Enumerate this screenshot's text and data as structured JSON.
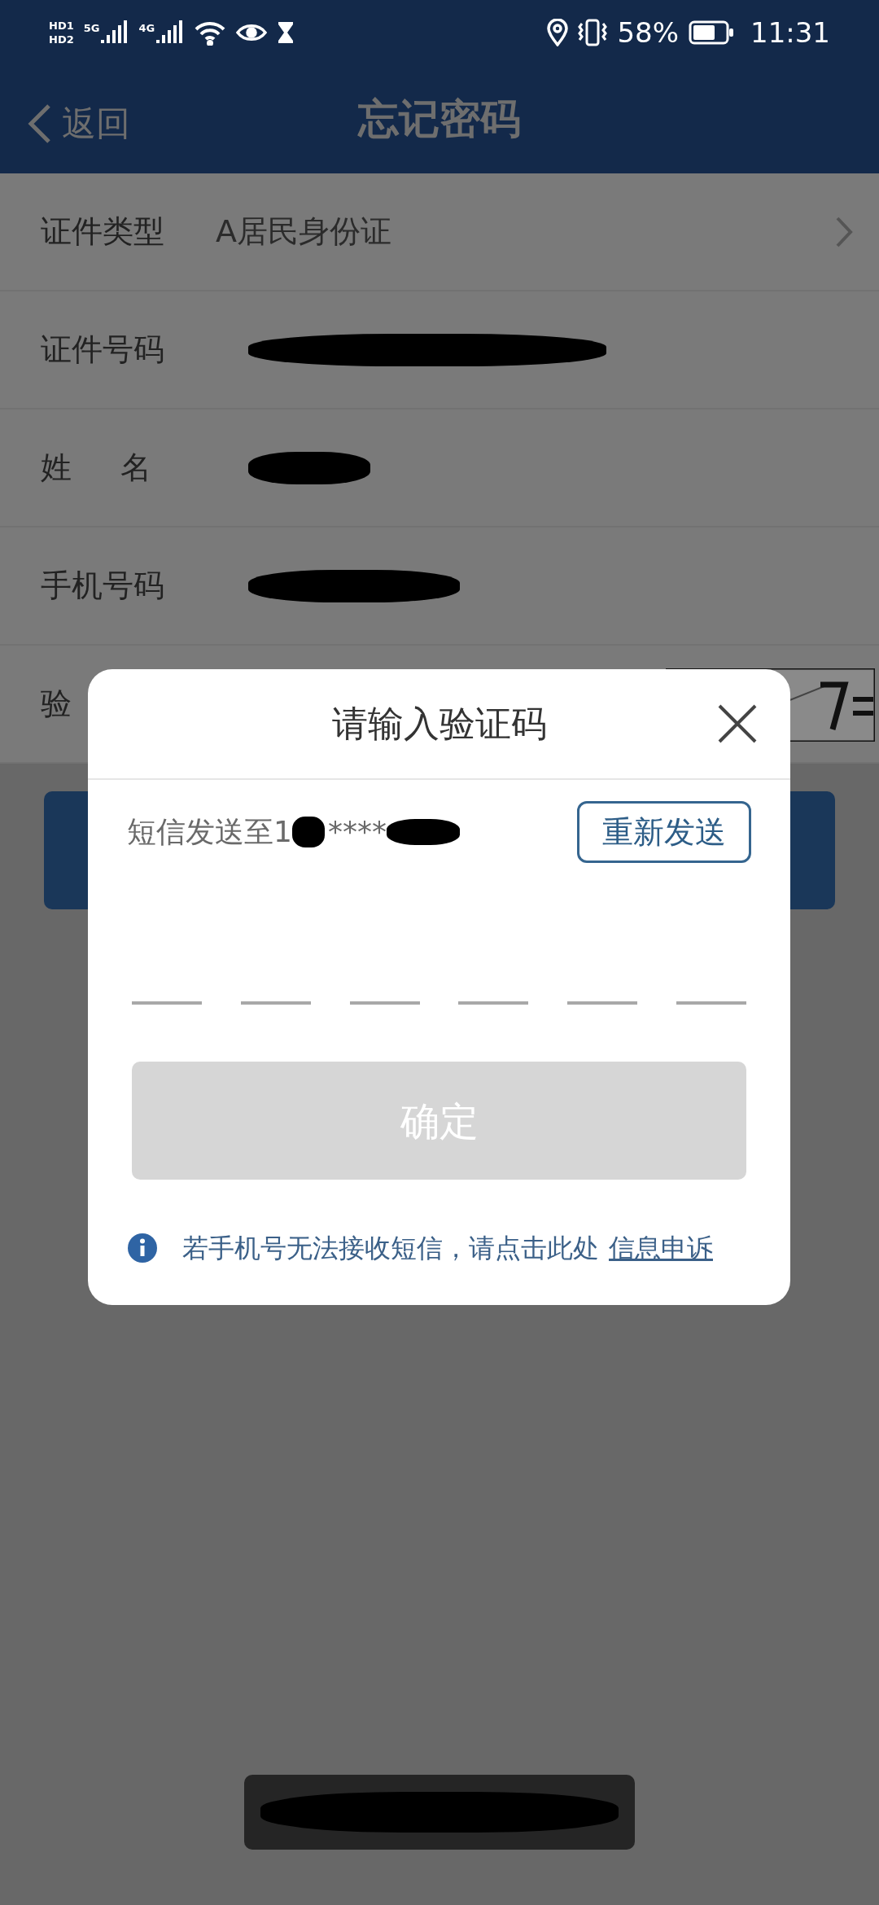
{
  "status_bar": {
    "sim_badges": [
      "HD1",
      "HD2"
    ],
    "networks": [
      "5G",
      "4G"
    ],
    "battery": "58%",
    "time": "11:31"
  },
  "header": {
    "back": "返回",
    "title": "忘记密码"
  },
  "form": {
    "rows": [
      {
        "kind": "select",
        "label": "证件类型",
        "value": "A居民身份证"
      },
      {
        "kind": "redacted",
        "label": "证件号码"
      },
      {
        "kind": "redacted",
        "label": "姓     名"
      },
      {
        "kind": "redacted",
        "label": "手机号码"
      },
      {
        "kind": "captcha",
        "label": "验"
      }
    ]
  },
  "dialog": {
    "title": "请输入验证码",
    "sms_prefix": "短信发送至1",
    "sms_mask": "****",
    "resend": "重新发送",
    "code_slots": [
      {
        "filled": false
      },
      {
        "filled": false
      },
      {
        "filled": false
      },
      {
        "filled": false
      },
      {
        "filled": false
      },
      {
        "filled": false
      }
    ],
    "confirm": "确定",
    "confirm_disabled": true,
    "help_text": "若手机号无法接收短信，请点击此处",
    "help_link": "信息申诉"
  },
  "toast": {
    "kind": "redacted"
  }
}
